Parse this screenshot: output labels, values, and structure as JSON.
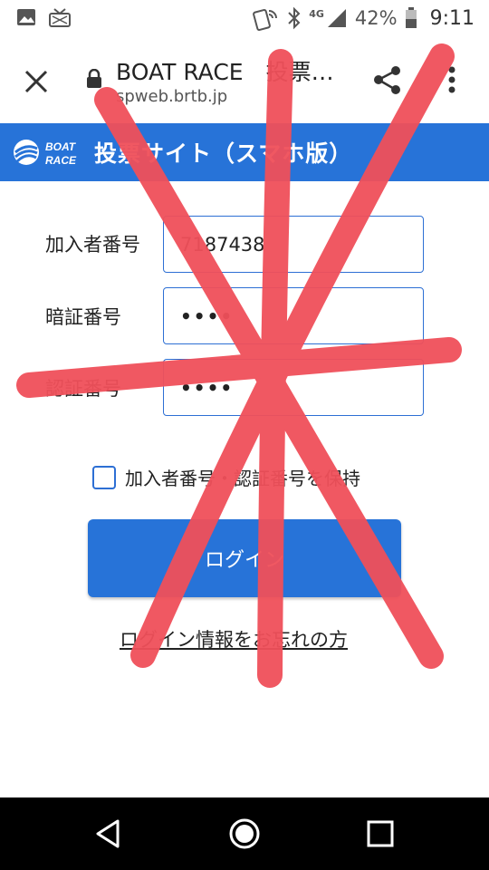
{
  "status_bar": {
    "network": "4G",
    "battery_percent": "42%",
    "time": "9:11",
    "icons": [
      "image-icon",
      "tv-icon",
      "nfc-icon",
      "bluetooth-icon",
      "signal-icon",
      "battery-icon"
    ]
  },
  "browser": {
    "title": "BOAT RACE　投票…",
    "url": "spweb.brtb.jp",
    "icons": [
      "close-icon",
      "lock-icon",
      "share-icon",
      "more-icon"
    ]
  },
  "site": {
    "logo_line1": "BOAT",
    "logo_line2": "RACE",
    "title": "投票サイト（スマホ版）",
    "accent_color": "#2773d8"
  },
  "form": {
    "member_label": "加入者番号",
    "member_value": "7187438",
    "pin_label": "暗証番号",
    "pin_value": "••••",
    "auth_label": "認証番号",
    "auth_value": "••••",
    "remember_label": "加入者番号・認証番号を保持",
    "remember_checked": false,
    "login_button": "ログイン",
    "forgot_link": "ログイン情報をお忘れの方"
  },
  "overlay": {
    "stroke_color": "#f0505a",
    "description": "red X strokes"
  },
  "navbar": {
    "icons": [
      "back-icon",
      "home-icon",
      "recent-apps-icon"
    ]
  }
}
